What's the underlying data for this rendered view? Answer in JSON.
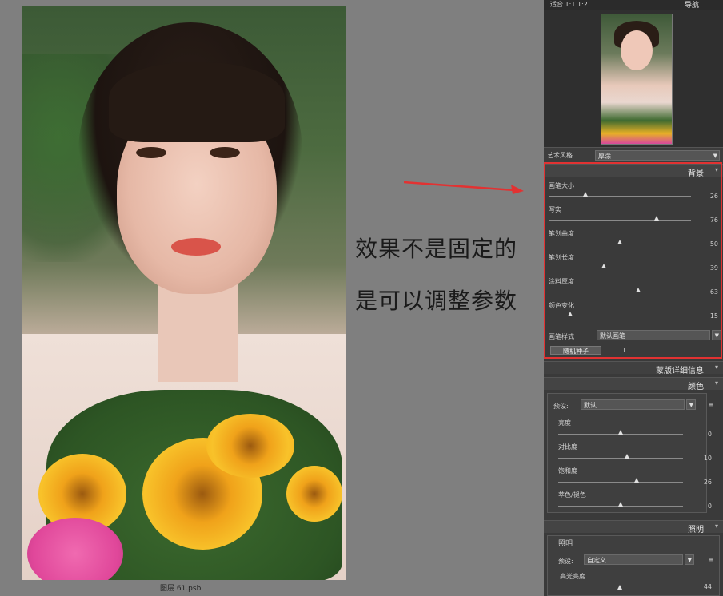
{
  "canvas": {
    "document_label": "图层 61.psb",
    "annotation_line1": "效果不是固定的",
    "annotation_line2": "是可以调整参数"
  },
  "panel": {
    "top_left_tabs": "适合  1:1  1:2",
    "navigator_title": "导航",
    "art_style_label": "艺术风格",
    "art_style_value": "厚涂",
    "background_section": {
      "title": "背景",
      "sliders": [
        {
          "label": "画笔大小",
          "value": "26",
          "level": 0.26
        },
        {
          "label": "写实",
          "value": "76",
          "level": 0.76
        },
        {
          "label": "笔划曲度",
          "value": "50",
          "level": 0.5
        },
        {
          "label": "笔划长度",
          "value": "39",
          "level": 0.39
        },
        {
          "label": "涂料厚度",
          "value": "63",
          "level": 0.63
        },
        {
          "label": "颜色变化",
          "value": "15",
          "level": 0.15
        }
      ],
      "brush_style_label": "画笔样式",
      "brush_style_value": "默认画笔",
      "random_seed_button": "随机种子",
      "random_seed_value": "1"
    },
    "mask_details_title": "蒙版详细信息",
    "color_section": {
      "title": "颜色",
      "preset_label": "预设:",
      "preset_value": "默认",
      "sliders": [
        {
          "label": "亮度",
          "value": "0",
          "level": 0.5
        },
        {
          "label": "对比度",
          "value": "10",
          "level": 0.55
        },
        {
          "label": "饱和度",
          "value": "26",
          "level": 0.63
        },
        {
          "label": "萃色/褪色",
          "value": "0",
          "level": 0.5
        }
      ]
    },
    "lighting_section": {
      "title": "照明",
      "subtitle": "照明",
      "preset_label": "预设:",
      "preset_value": "自定义",
      "highlight_label": "高光亮度",
      "highlight_value": "44",
      "highlight_level": 0.44
    }
  },
  "colors": {
    "highlight_box": "#e23232",
    "panel_bg": "#3a3a3a"
  }
}
